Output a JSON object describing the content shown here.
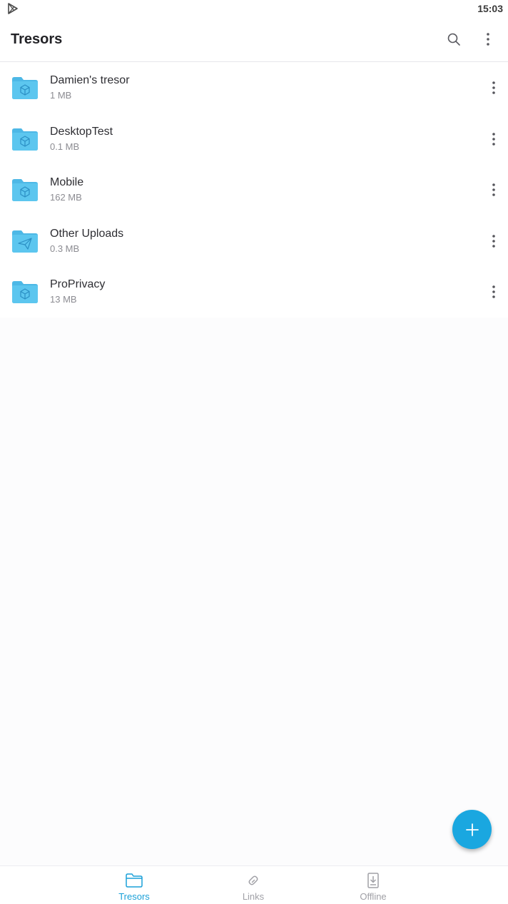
{
  "status_bar": {
    "time": "15:03",
    "notification_icon": "play-store-icon"
  },
  "app_bar": {
    "title": "Tresors",
    "search_icon": "search-icon",
    "more_icon": "more-vertical-icon"
  },
  "tresors": [
    {
      "name": "Damien's tresor",
      "size": "1 MB",
      "icon": "folder-cube-icon"
    },
    {
      "name": "DesktopTest",
      "size": "0.1 MB",
      "icon": "folder-cube-icon"
    },
    {
      "name": "Mobile",
      "size": "162 MB",
      "icon": "folder-cube-icon"
    },
    {
      "name": "Other Uploads",
      "size": "0.3 MB",
      "icon": "folder-send-icon"
    },
    {
      "name": "ProPrivacy",
      "size": "13 MB",
      "icon": "folder-cube-icon"
    }
  ],
  "fab": {
    "icon": "plus-icon"
  },
  "bottom_nav": {
    "items": [
      {
        "label": "Tresors",
        "icon": "folder-icon",
        "active": true
      },
      {
        "label": "Links",
        "icon": "link-icon",
        "active": false
      },
      {
        "label": "Offline",
        "icon": "offline-download-icon",
        "active": false
      }
    ]
  },
  "colors": {
    "accent": "#1aa7e0",
    "folder": "#5cc6ef",
    "folder_tab": "#4db8e6",
    "folder_symbol": "#2b8fc4"
  }
}
